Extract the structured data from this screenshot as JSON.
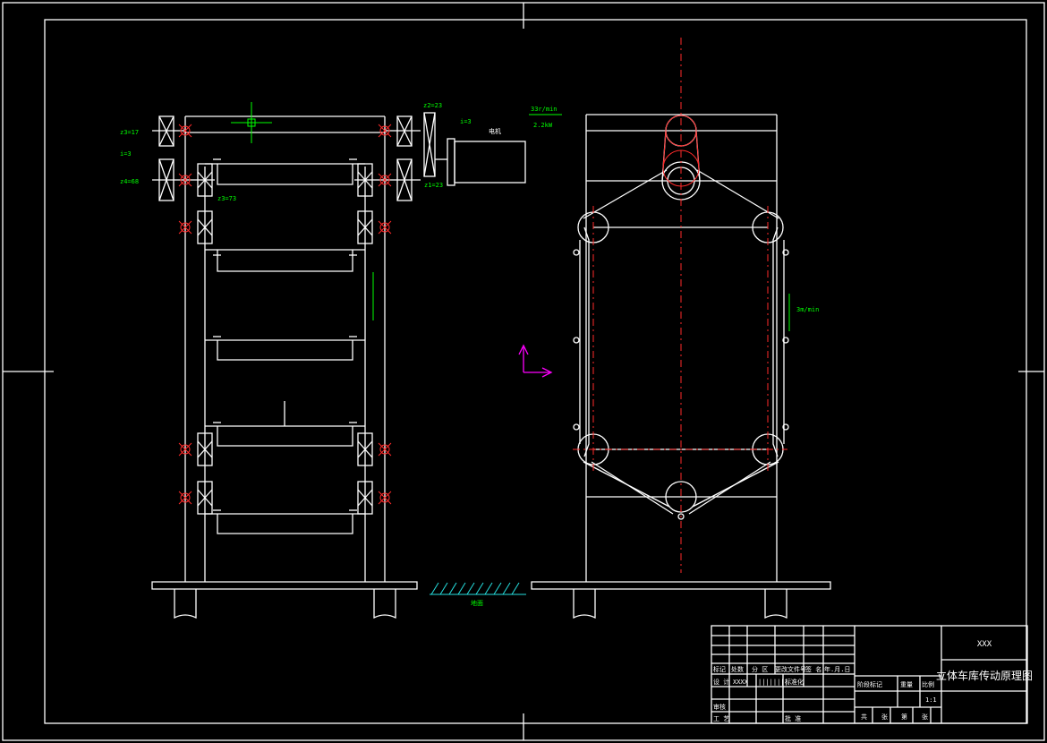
{
  "notes": {
    "z3": "z3=17",
    "i_left": "i=3",
    "z4": "z4=68",
    "z_mid": "z3=73",
    "z2": "z2=23",
    "z1": "z1=23",
    "i_right": "i=3",
    "motor": "电机",
    "speed_top": "33r/min",
    "speed_bottom": "2.2kW",
    "chain_speed": "3m/min",
    "ground": "地面"
  },
  "title_block": {
    "company": "XXX",
    "drawing_title": "立体车库传动原理图",
    "header_row": [
      "标记",
      "处数",
      "分 区",
      "更改文件号",
      "签 名",
      "年.月.日"
    ],
    "design_row": [
      "设 计",
      "XXXX",
      "||||||||",
      "标准化"
    ],
    "stage_headers": [
      "阶段标记",
      "重量",
      "比例"
    ],
    "scale": "1:1",
    "review": "审核",
    "process": "工 艺",
    "approve": "批 准",
    "sheet_row": [
      "共",
      "张",
      "第",
      "张"
    ]
  },
  "colors": {
    "background": "#000000",
    "line": "#ffffff",
    "bearing": "#ff2a2a",
    "dimension": "#00ff00",
    "hatch": "#26e0e0",
    "ucs": "#ff00ff"
  }
}
